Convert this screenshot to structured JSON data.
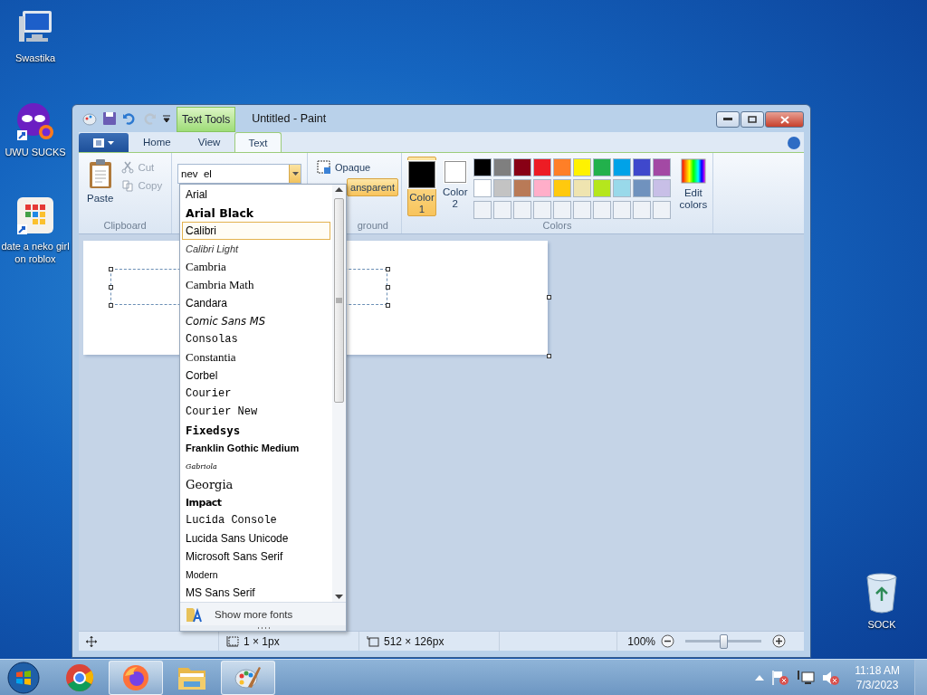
{
  "desktop_icons": [
    {
      "label": "Swastika",
      "kind": "computer"
    },
    {
      "label": "UWU SUCKS",
      "kind": "mask"
    },
    {
      "label": "date a neko girl on roblox",
      "kind": "grid"
    },
    {
      "label": "SOCK",
      "kind": "bin"
    }
  ],
  "window": {
    "title": "Untitled - Paint",
    "context_tab": "Text Tools"
  },
  "tabs": [
    {
      "label": "Home",
      "selected": false
    },
    {
      "label": "View",
      "selected": false
    },
    {
      "label": "Text",
      "selected": true
    }
  ],
  "clipboard": {
    "paste": "Paste",
    "cut": {
      "label": "Cut",
      "disabled": true
    },
    "copy": {
      "label": "Copy",
      "disabled": true
    },
    "group_label": "Clipboard"
  },
  "font_field": {
    "value": "nev  el"
  },
  "background": {
    "opaque": {
      "label": "Opaque",
      "selected": false
    },
    "transparent": {
      "label": "ansparent",
      "selected": true
    },
    "group_label": "ground"
  },
  "colors": {
    "color1": {
      "label": "Color",
      "number": "1",
      "color": "#000000",
      "selected": true
    },
    "color2": {
      "label": "Color",
      "number": "2",
      "color": "#ffffff",
      "selected": false
    },
    "palette": [
      {
        "color": "#000000"
      },
      {
        "color": "#7f7f7f"
      },
      {
        "color": "#880015"
      },
      {
        "color": "#ed1c24"
      },
      {
        "color": "#ff7f27"
      },
      {
        "color": "#fff200"
      },
      {
        "color": "#22b14c"
      },
      {
        "color": "#00a2e8"
      },
      {
        "color": "#3f48cc"
      },
      {
        "color": "#a349a4"
      },
      {
        "color": "#ffffff"
      },
      {
        "color": "#c3c3c3"
      },
      {
        "color": "#b97a57"
      },
      {
        "color": "#ffaec9"
      },
      {
        "color": "#ffc90e"
      },
      {
        "color": "#efe4b0"
      },
      {
        "color": "#b5e61d"
      },
      {
        "color": "#99d9ea"
      },
      {
        "color": "#7092be"
      },
      {
        "color": "#c8bfe7"
      }
    ],
    "edit": "Edit colors",
    "group_label": "Colors"
  },
  "font_list": {
    "items": [
      {
        "label": "Arial",
        "kind": "sans",
        "selected": false
      },
      {
        "label": "Arial Black",
        "kind": "black",
        "selected": false
      },
      {
        "label": "Calibri",
        "kind": "sans",
        "selected": true
      },
      {
        "label": "Calibri Light",
        "kind": "italic",
        "selected": false
      },
      {
        "label": "Cambria",
        "kind": "serif",
        "selected": false
      },
      {
        "label": "Cambria Math",
        "kind": "serif",
        "selected": false
      },
      {
        "label": "Candara",
        "kind": "sans",
        "selected": false
      },
      {
        "label": "Comic Sans MS",
        "kind": "comic",
        "selected": false
      },
      {
        "label": "Consolas",
        "kind": "mono",
        "selected": false
      },
      {
        "label": "Constantia",
        "kind": "serif",
        "selected": false
      },
      {
        "label": "Corbel",
        "kind": "sans",
        "selected": false
      },
      {
        "label": "Courier",
        "kind": "mono",
        "selected": false
      },
      {
        "label": "Courier New",
        "kind": "mono",
        "selected": false
      },
      {
        "label": "Fixedsys",
        "kind": "fixed",
        "selected": false
      },
      {
        "label": "Franklin Gothic Medium",
        "kind": "franklin",
        "selected": false
      },
      {
        "label": "Gabriola",
        "kind": "script",
        "selected": false
      },
      {
        "label": "Georgia",
        "kind": "georgia",
        "selected": false
      },
      {
        "label": "Impact",
        "kind": "impact",
        "selected": false
      },
      {
        "label": "Lucida Console",
        "kind": "mono",
        "selected": false
      },
      {
        "label": "Lucida Sans Unicode",
        "kind": "sans",
        "selected": false
      },
      {
        "label": "Microsoft Sans Serif",
        "kind": "sans",
        "selected": false
      },
      {
        "label": "Modern",
        "kind": "small",
        "selected": false
      },
      {
        "label": "MS Sans Serif",
        "kind": "sans",
        "selected": false
      }
    ],
    "more": "Show more fonts"
  },
  "status_bar": {
    "selection": "1 × 1px",
    "size": "512 × 126px",
    "zoom": "100%",
    "zoom_slider": {
      "level": 0.5
    }
  },
  "taskbar": {
    "apps": [
      {
        "kind": "chrome",
        "active": false
      },
      {
        "kind": "firefox",
        "active": true
      },
      {
        "kind": "explorer",
        "active": false
      },
      {
        "kind": "paint",
        "active": true
      }
    ],
    "clock": {
      "time": "11:18 AM",
      "date": "7/3/2023"
    }
  }
}
